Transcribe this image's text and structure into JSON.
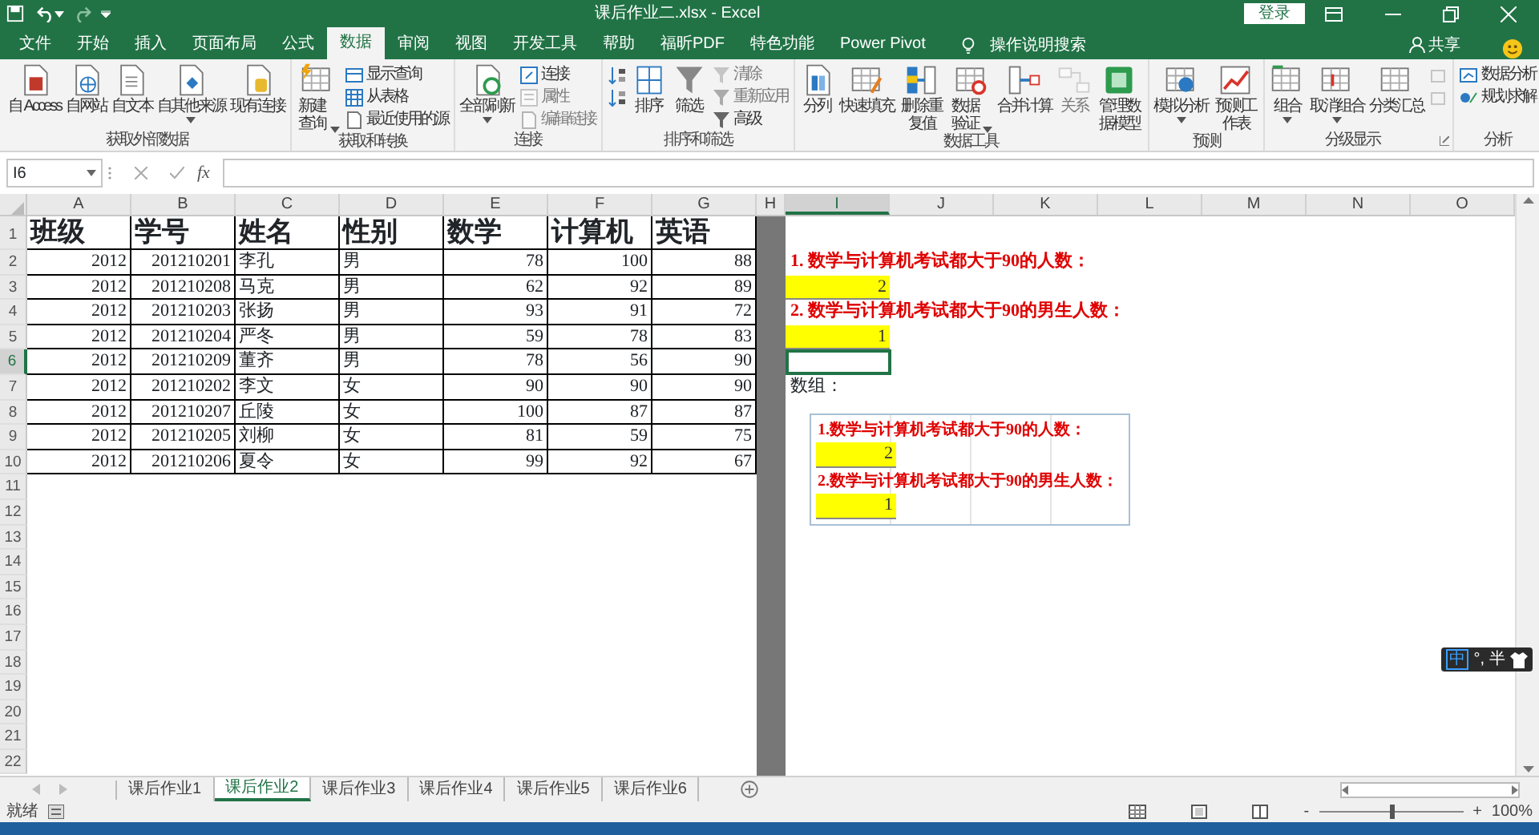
{
  "title_bar": {
    "title": "课后作业二.xlsx - Excel",
    "sign_in": "登录"
  },
  "ribbon_tabs": [
    {
      "label": "文件",
      "selected": false
    },
    {
      "label": "开始",
      "selected": false
    },
    {
      "label": "插入",
      "selected": false
    },
    {
      "label": "页面布局",
      "selected": false
    },
    {
      "label": "公式",
      "selected": false
    },
    {
      "label": "数据",
      "selected": true
    },
    {
      "label": "审阅",
      "selected": false
    },
    {
      "label": "视图",
      "selected": false
    },
    {
      "label": "开发工具",
      "selected": false
    },
    {
      "label": "帮助",
      "selected": false
    },
    {
      "label": "福昕PDF",
      "selected": false
    },
    {
      "label": "特色功能",
      "selected": false
    },
    {
      "label": "Power Pivot",
      "selected": false
    }
  ],
  "tell_me": "操作说明搜索",
  "share": "共享",
  "ribbon_groups": [
    {
      "label": "获取外部数据",
      "launcher": false,
      "items": [
        {
          "kind": "large",
          "label": "自 Access",
          "disabled": false,
          "dropdown": false,
          "wrap": false
        },
        {
          "kind": "large",
          "label": "自网站",
          "disabled": false,
          "dropdown": false,
          "wrap": false
        },
        {
          "kind": "large",
          "label": "自文本",
          "disabled": false,
          "dropdown": false,
          "wrap": false
        },
        {
          "kind": "large",
          "label": "自其他来源",
          "disabled": false,
          "dropdown": true,
          "wrap": false
        },
        {
          "kind": "large",
          "label": "现有连接",
          "disabled": false,
          "dropdown": false,
          "wrap": false
        }
      ]
    },
    {
      "label": "获取和转换",
      "launcher": false,
      "items": [
        {
          "kind": "large",
          "label": "新建查询",
          "disabled": false,
          "dropdown": true,
          "wrap": true
        },
        {
          "kind": "stack",
          "items": [
            {
              "label": "显示查询",
              "disabled": false
            },
            {
              "label": "从表格",
              "disabled": false
            },
            {
              "label": "最近使用的源",
              "disabled": false
            }
          ]
        }
      ]
    },
    {
      "label": "连接",
      "launcher": false,
      "items": [
        {
          "kind": "large",
          "label": "全部刷新",
          "disabled": false,
          "dropdown": true,
          "wrap": false
        },
        {
          "kind": "stack",
          "items": [
            {
              "label": "连接",
              "disabled": false
            },
            {
              "label": "属性",
              "disabled": true
            },
            {
              "label": "编辑链接",
              "disabled": true
            }
          ]
        }
      ]
    },
    {
      "label": "排序和筛选",
      "launcher": false,
      "items": [
        {
          "kind": "stack",
          "items": [
            {
              "disabled": false
            },
            {
              "disabled": false
            }
          ]
        },
        {
          "kind": "large",
          "label": "排序",
          "disabled": false,
          "dropdown": false,
          "wrap": false
        },
        {
          "kind": "large",
          "label": "筛选",
          "disabled": false,
          "dropdown": false,
          "wrap": false
        },
        {
          "kind": "stack",
          "items": [
            {
              "label": "清除",
              "disabled": true
            },
            {
              "label": "重新应用",
              "disabled": true
            },
            {
              "label": "高级",
              "disabled": false
            }
          ]
        }
      ]
    },
    {
      "label": "数据工具",
      "launcher": false,
      "items": [
        {
          "kind": "large",
          "label": "分列",
          "disabled": false,
          "dropdown": false,
          "wrap": false
        },
        {
          "kind": "large",
          "label": "快速填充",
          "disabled": false,
          "dropdown": false,
          "wrap": false
        },
        {
          "kind": "large",
          "label": "删除重复值",
          "disabled": false,
          "dropdown": false,
          "wrap": true
        },
        {
          "kind": "large",
          "label": "数据验证",
          "disabled": false,
          "dropdown": true,
          "wrap": true
        },
        {
          "kind": "large",
          "label": "合并计算",
          "disabled": false,
          "dropdown": false,
          "wrap": false
        },
        {
          "kind": "large",
          "label": "关系",
          "disabled": true,
          "dropdown": false,
          "wrap": false
        },
        {
          "kind": "large",
          "label": "管理数据模型",
          "disabled": false,
          "dropdown": false,
          "wrap": true
        }
      ]
    },
    {
      "label": "预测",
      "launcher": false,
      "items": [
        {
          "kind": "large",
          "label": "模拟分析",
          "disabled": false,
          "dropdown": true,
          "wrap": false
        },
        {
          "kind": "large",
          "label": "预测工作表",
          "disabled": false,
          "dropdown": false,
          "wrap": true
        }
      ]
    },
    {
      "label": "分级显示",
      "launcher": true,
      "items": [
        {
          "kind": "large",
          "label": "组合",
          "disabled": false,
          "dropdown": true,
          "wrap": false
        },
        {
          "kind": "large",
          "label": "取消组合",
          "disabled": false,
          "dropdown": true,
          "wrap": false
        },
        {
          "kind": "large",
          "label": "分类汇总",
          "disabled": false,
          "dropdown": false,
          "wrap": false
        },
        {
          "kind": "stack",
          "items": [
            {
              "disabled": true
            },
            {
              "disabled": true
            }
          ]
        }
      ]
    },
    {
      "label": "分析",
      "launcher": false,
      "items": [
        {
          "kind": "stack",
          "items": [
            {
              "label": "数据分析",
              "disabled": false
            },
            {
              "label": "规划求解",
              "disabled": false
            }
          ]
        }
      ]
    }
  ],
  "formula_bar": {
    "name_box": "I6",
    "fx_label": "fx"
  },
  "sheet": {
    "column_letters_left": [
      {
        "label": "A",
        "selected": false
      },
      {
        "label": "B",
        "selected": false
      },
      {
        "label": "C",
        "selected": false
      },
      {
        "label": "D",
        "selected": false
      },
      {
        "label": "E",
        "selected": false
      },
      {
        "label": "F",
        "selected": false
      },
      {
        "label": "G",
        "selected": false
      }
    ],
    "split_column_letter": "H",
    "column_letters_right": [
      {
        "label": "I",
        "selected": true
      },
      {
        "label": "J",
        "selected": false
      },
      {
        "label": "K",
        "selected": false
      },
      {
        "label": "L",
        "selected": false
      },
      {
        "label": "M",
        "selected": false
      },
      {
        "label": "N",
        "selected": false
      },
      {
        "label": "O",
        "selected": false
      }
    ],
    "row_numbers": [
      {
        "label": "1",
        "selected": false
      },
      {
        "label": "2",
        "selected": false
      },
      {
        "label": "3",
        "selected": false
      },
      {
        "label": "4",
        "selected": false
      },
      {
        "label": "5",
        "selected": false
      },
      {
        "label": "6",
        "selected": true
      },
      {
        "label": "7",
        "selected": false
      },
      {
        "label": "8",
        "selected": false
      },
      {
        "label": "9",
        "selected": false
      },
      {
        "label": "10",
        "selected": false
      },
      {
        "label": "11",
        "selected": false
      },
      {
        "label": "12",
        "selected": false
      },
      {
        "label": "13",
        "selected": false
      },
      {
        "label": "14",
        "selected": false
      },
      {
        "label": "15",
        "selected": false
      },
      {
        "label": "16",
        "selected": false
      },
      {
        "label": "17",
        "selected": false
      },
      {
        "label": "18",
        "selected": false
      },
      {
        "label": "19",
        "selected": false
      },
      {
        "label": "20",
        "selected": false
      },
      {
        "label": "21",
        "selected": false
      },
      {
        "label": "22",
        "selected": false
      }
    ],
    "columns": [
      {
        "heading": "班级",
        "numeric": true
      },
      {
        "heading": "学号",
        "numeric": true
      },
      {
        "heading": "姓名",
        "numeric": false
      },
      {
        "heading": "性别",
        "numeric": false
      },
      {
        "heading": "数学",
        "numeric": true
      },
      {
        "heading": "计算机",
        "numeric": true
      },
      {
        "heading": "英语",
        "numeric": true
      }
    ],
    "rows": [
      [
        "2012",
        "201210201",
        "李孔",
        "男",
        "78",
        "100",
        "88"
      ],
      [
        "2012",
        "201210208",
        "马克",
        "男",
        "62",
        "92",
        "89"
      ],
      [
        "2012",
        "201210203",
        "张扬",
        "男",
        "93",
        "91",
        "72"
      ],
      [
        "2012",
        "201210204",
        "严冬",
        "男",
        "59",
        "78",
        "83"
      ],
      [
        "2012",
        "201210209",
        "董齐",
        "男",
        "78",
        "56",
        "90"
      ],
      [
        "2012",
        "201210202",
        "李文",
        "女",
        "90",
        "90",
        "90"
      ],
      [
        "2012",
        "201210207",
        "丘陵",
        "女",
        "100",
        "87",
        "87"
      ],
      [
        "2012",
        "201210205",
        "刘柳",
        "女",
        "81",
        "59",
        "75"
      ],
      [
        "2012",
        "201210206",
        "夏令",
        "女",
        "99",
        "92",
        "67"
      ]
    ],
    "right_rows": [
      {
        "kind": "empty"
      },
      {
        "kind": "label",
        "text": "1. 数学与计算机考试都大于90的人数："
      },
      {
        "kind": "result",
        "text": "2"
      },
      {
        "kind": "label",
        "text": "2. 数学与计算机考试都大于90的男生人数："
      },
      {
        "kind": "result",
        "text": "1"
      },
      {
        "kind": "active"
      },
      {
        "kind": "plain",
        "text": "数组："
      }
    ],
    "embedded_image": [
      {
        "kind": "label",
        "text": "1.数学与计算机考试都大于90的人数："
      },
      {
        "kind": "result",
        "text": "2"
      },
      {
        "kind": "label",
        "text": "2.数学与计算机考试都大于90的男生人数："
      },
      {
        "kind": "result",
        "text": "1"
      }
    ]
  },
  "ime_bar": [
    "中",
    "°,",
    "半"
  ],
  "sheet_tabs": [
    {
      "label": "课后作业1",
      "selected": false
    },
    {
      "label": "课后作业2",
      "selected": true
    },
    {
      "label": "课后作业3",
      "selected": false
    },
    {
      "label": "课后作业4",
      "selected": false
    },
    {
      "label": "课后作业5",
      "selected": false
    },
    {
      "label": "课后作业6",
      "selected": false
    }
  ],
  "status_bar": {
    "text": "就绪",
    "zoom_out": "-",
    "zoom_in": "+",
    "zoom": "100%",
    "zoom_slider": {
      "level": 0.5
    }
  }
}
